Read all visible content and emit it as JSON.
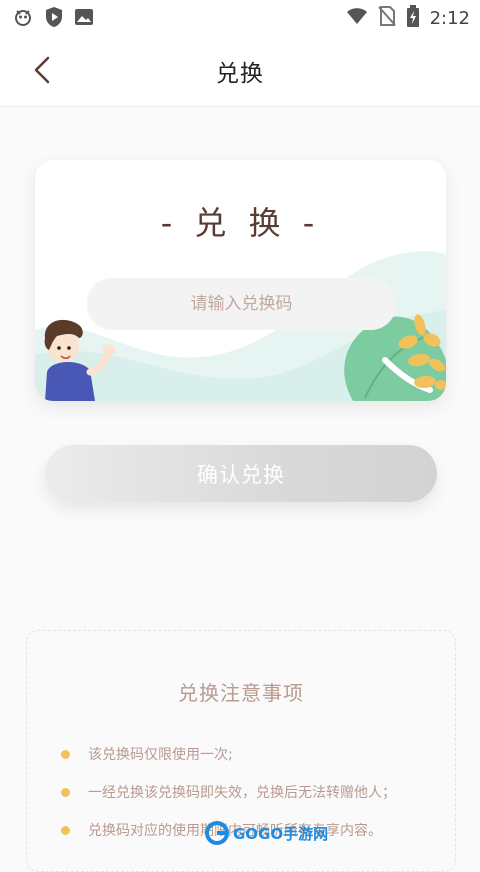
{
  "status_bar": {
    "time": "2:12",
    "icons": [
      "bug-icon",
      "shield-play-icon",
      "image-icon",
      "wifi-icon",
      "no-sim-icon",
      "battery-charging-icon"
    ]
  },
  "header": {
    "title": "兑换",
    "back_icon": "chevron-left-icon"
  },
  "card": {
    "heading": "- 兑 换 -",
    "input_placeholder": "请输入兑换码",
    "input_value": ""
  },
  "confirm_button": {
    "label": "确认兑换"
  },
  "notice": {
    "title": "兑换注意事项",
    "items": [
      "该兑换码仅限使用一次;",
      "一经兑换该兑换码即失效，兑换后无法转赠他人；",
      "兑换码对应的使用期限内可畅听所有专享内容。"
    ]
  },
  "watermark": {
    "text": "GOGO手游网"
  },
  "colors": {
    "accent_bullet": "#f2c15a",
    "heading_brown": "#5a3b34",
    "muted_text": "#b89a90",
    "leaf_green": "#7ccba1"
  }
}
